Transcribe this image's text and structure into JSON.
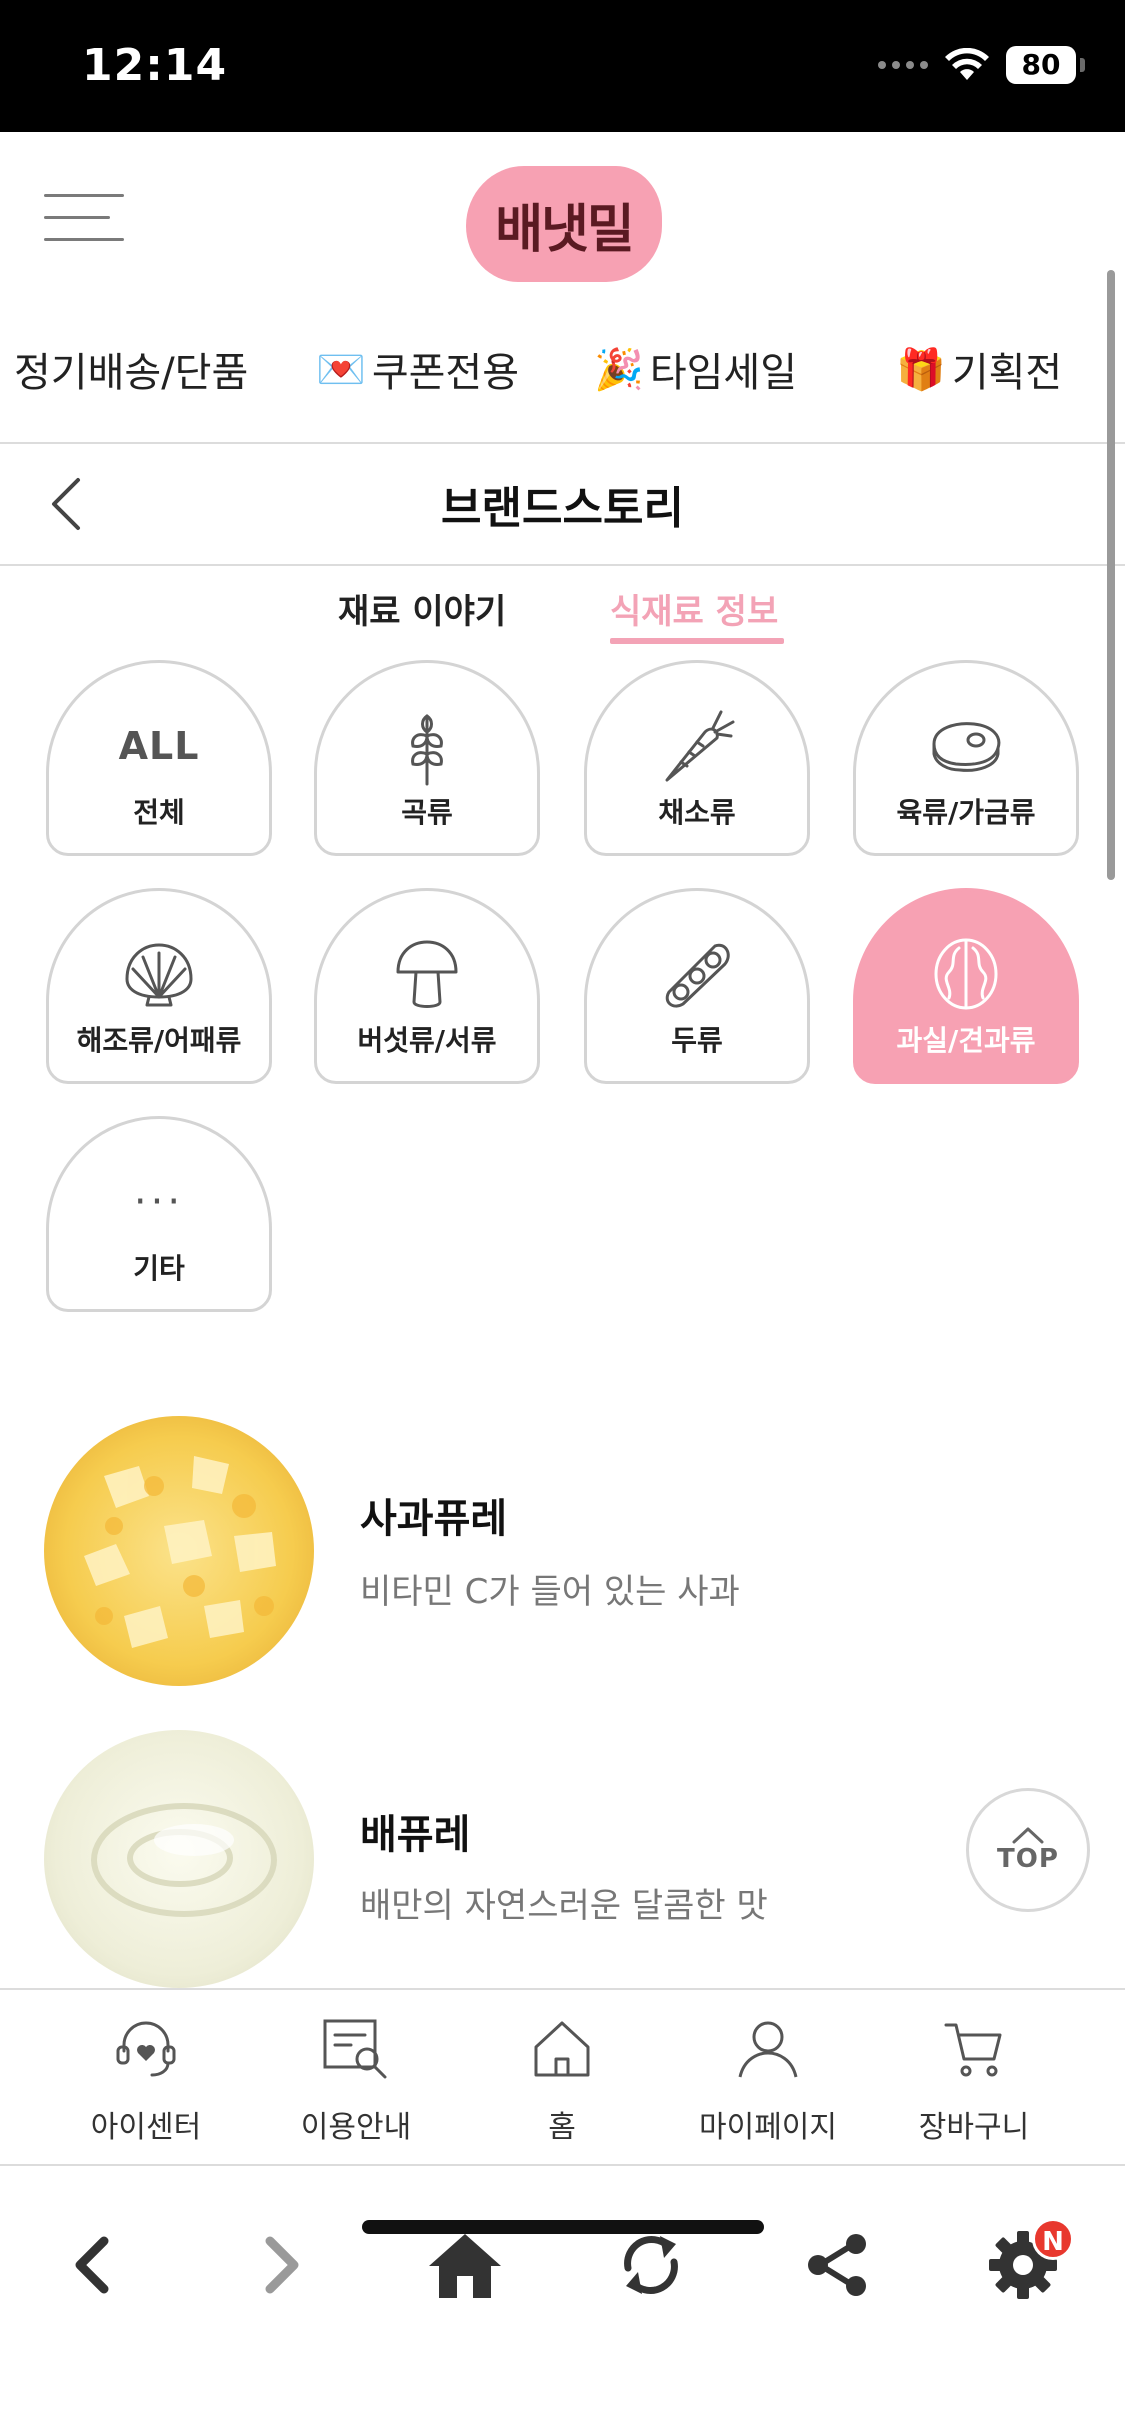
{
  "status_bar": {
    "time": "12:14",
    "battery": "80"
  },
  "header": {
    "logo": "배냇밀"
  },
  "top_nav": [
    {
      "label": "정기배송/단품",
      "emoji": ""
    },
    {
      "label": "쿠폰전용",
      "emoji": "💌"
    },
    {
      "label": "타임세일",
      "emoji": "🎉"
    },
    {
      "label": "기획전",
      "emoji": "🎁"
    }
  ],
  "page": {
    "title": "브랜드스토리"
  },
  "tabs": {
    "story": "재료 이야기",
    "info": "식재료 정보",
    "active": "info"
  },
  "categories": [
    {
      "icon": "all",
      "label": "전체",
      "all_text": "ALL"
    },
    {
      "icon": "grain-icon",
      "label": "곡류"
    },
    {
      "icon": "carrot-icon",
      "label": "채소류"
    },
    {
      "icon": "meat-icon",
      "label": "육류/가금류"
    },
    {
      "icon": "shell-icon",
      "label": "해조류/어패류"
    },
    {
      "icon": "mushroom-icon",
      "label": "버섯류/서류"
    },
    {
      "icon": "bean-icon",
      "label": "두류"
    },
    {
      "icon": "walnut-icon",
      "label": "과실/견과류",
      "active": true
    },
    {
      "icon": "more-icon",
      "label": "기타",
      "dots": "···"
    }
  ],
  "products": [
    {
      "name": "사과퓨레",
      "desc": "비타민 C가 들어 있는 사과"
    },
    {
      "name": "배퓨레",
      "desc": "배만의 자연스러운 달콤한 맛"
    }
  ],
  "top_button": {
    "label": "TOP"
  },
  "bottom_nav": [
    {
      "icon": "headset-heart-icon",
      "label": "아이센터"
    },
    {
      "icon": "guide-search-icon",
      "label": "이용안내"
    },
    {
      "icon": "house-icon",
      "label": "홈"
    },
    {
      "icon": "person-icon",
      "label": "마이페이지"
    },
    {
      "icon": "cart-icon",
      "label": "장바구니"
    }
  ],
  "browser_bar": {
    "badge": "N"
  },
  "colors": {
    "accent_pink": "#f7a1b3",
    "tab_pink": "#f3a3b6",
    "logo_text": "#5a1a22"
  }
}
